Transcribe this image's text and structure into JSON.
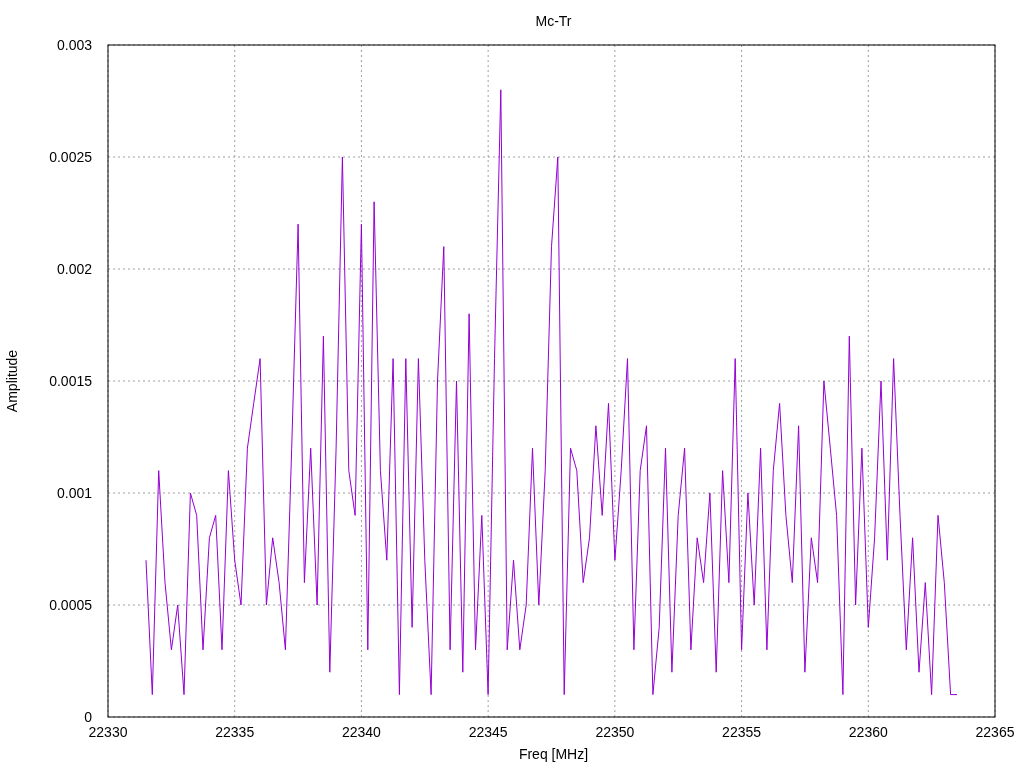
{
  "chart_data": {
    "type": "line",
    "title": "Mc-Tr",
    "grid": true,
    "xlabel": "Freq [MHz]",
    "ylabel": "Amplitude",
    "xlim": [
      22330,
      22365
    ],
    "ylim": [
      0,
      0.003
    ],
    "xticks": [
      22330,
      22335,
      22340,
      22345,
      22350,
      22355,
      22360,
      22365
    ],
    "yticks": [
      0,
      0.0005,
      0.001,
      0.0015,
      0.002,
      0.0025,
      0.003
    ],
    "x": [
      22331.5,
      22331.75,
      22332,
      22332.25,
      22332.5,
      22332.75,
      22333,
      22333.25,
      22333.5,
      22333.75,
      22334,
      22334.25,
      22334.5,
      22334.75,
      22335,
      22335.25,
      22335.5,
      22335.75,
      22336,
      22336.25,
      22336.5,
      22336.75,
      22337,
      22337.25,
      22337.5,
      22337.75,
      22338,
      22338.25,
      22338.5,
      22338.75,
      22339,
      22339.25,
      22339.5,
      22339.75,
      22340,
      22340.25,
      22340.5,
      22340.75,
      22341,
      22341.25,
      22341.5,
      22341.75,
      22342,
      22342.25,
      22342.5,
      22342.75,
      22343,
      22343.25,
      22343.5,
      22343.75,
      22344,
      22344.25,
      22344.5,
      22344.75,
      22345,
      22345.25,
      22345.5,
      22345.75,
      22346,
      22346.25,
      22346.5,
      22346.75,
      22347,
      22347.25,
      22347.5,
      22347.75,
      22348,
      22348.25,
      22348.5,
      22348.75,
      22349,
      22349.25,
      22349.5,
      22349.75,
      22350,
      22350.25,
      22350.5,
      22350.75,
      22351,
      22351.25,
      22351.5,
      22351.75,
      22352,
      22352.25,
      22352.5,
      22352.75,
      22353,
      22353.25,
      22353.5,
      22353.75,
      22354,
      22354.25,
      22354.5,
      22354.75,
      22355,
      22355.25,
      22355.5,
      22355.75,
      22356,
      22356.25,
      22356.5,
      22356.75,
      22357,
      22357.25,
      22357.5,
      22357.75,
      22358,
      22358.25,
      22358.5,
      22358.75,
      22359,
      22359.25,
      22359.5,
      22359.75,
      22360,
      22360.25,
      22360.5,
      22360.75,
      22361,
      22361.25,
      22361.5,
      22361.75,
      22362,
      22362.25,
      22362.5,
      22362.75,
      22363,
      22363.25,
      22363.5
    ],
    "series": [
      {
        "color": "#9400d3",
        "values": [
          0.0007,
          0.0001,
          0.0011,
          0.0006,
          0.0003,
          0.0005,
          0.0001,
          0.001,
          0.0009,
          0.0003,
          0.0008,
          0.0009,
          0.0003,
          0.0011,
          0.0007,
          0.0005,
          0.0012,
          0.0014,
          0.0016,
          0.0005,
          0.0008,
          0.0006,
          0.0003,
          0.0012,
          0.0022,
          0.0006,
          0.0012,
          0.0005,
          0.0017,
          0.0002,
          0.0012,
          0.0025,
          0.0011,
          0.0009,
          0.0022,
          0.0003,
          0.0023,
          0.0011,
          0.0007,
          0.0016,
          0.0001,
          0.0016,
          0.0004,
          0.0016,
          0.0007,
          0.0001,
          0.0015,
          0.0021,
          0.0003,
          0.0015,
          0.0002,
          0.0018,
          0.0003,
          0.0009,
          0.0001,
          0.0016,
          0.0028,
          0.0003,
          0.0007,
          0.0003,
          0.0005,
          0.0012,
          0.0005,
          0.0011,
          0.0021,
          0.0025,
          0.0001,
          0.0012,
          0.0011,
          0.0006,
          0.0008,
          0.0013,
          0.0009,
          0.0014,
          0.0007,
          0.0011,
          0.0016,
          0.0003,
          0.0011,
          0.0013,
          0.0001,
          0.0004,
          0.0012,
          0.0002,
          0.0009,
          0.0012,
          0.0003,
          0.0008,
          0.0006,
          0.001,
          0.0002,
          0.0011,
          0.0006,
          0.0016,
          0.0003,
          0.001,
          0.0005,
          0.0012,
          0.0003,
          0.0011,
          0.0014,
          0.0009,
          0.0006,
          0.0013,
          0.0002,
          0.0008,
          0.0006,
          0.0015,
          0.0012,
          0.0009,
          0.0001,
          0.0017,
          0.0005,
          0.0012,
          0.0004,
          0.0008,
          0.0015,
          0.0007,
          0.0016,
          0.0009,
          0.0003,
          0.0008,
          0.0002,
          0.0006,
          0.0001,
          0.0009,
          0.0006,
          0.0001,
          0.0001
        ]
      }
    ]
  }
}
